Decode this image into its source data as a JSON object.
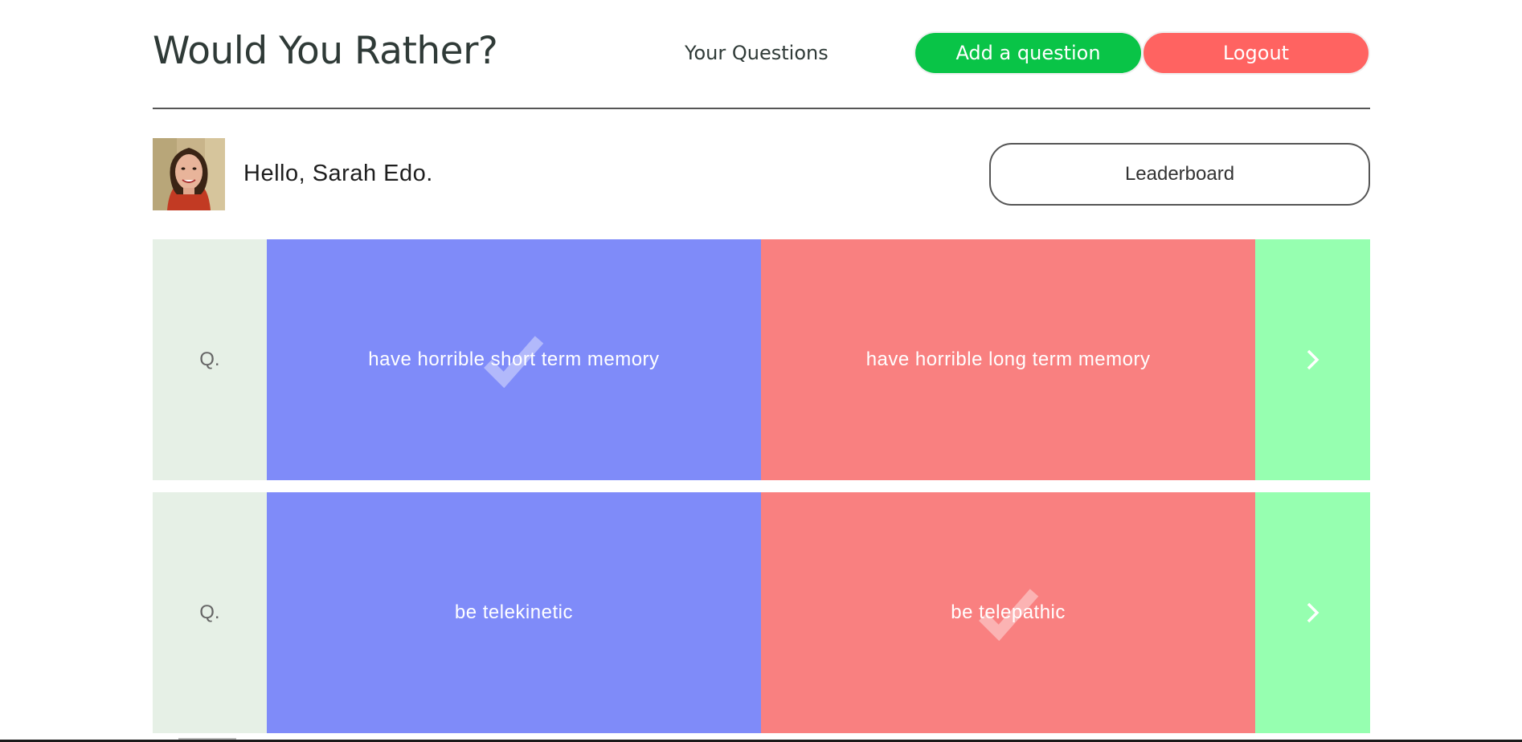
{
  "header": {
    "title": "Would You Rather?",
    "nav_your_questions": "Your Questions",
    "add_question_label": "Add a question",
    "logout_label": "Logout"
  },
  "user": {
    "greeting": "Hello, Sarah Edo.",
    "leaderboard_label": "Leaderboard"
  },
  "questions": [
    {
      "prefix": "Q.",
      "option_a": "have horrible short term memory",
      "option_b": "have horrible long term memory",
      "selected": "option_a"
    },
    {
      "prefix": "Q.",
      "option_a": "be telekinetic",
      "option_b": "be telepathic",
      "selected": "option_b"
    }
  ],
  "colors": {
    "add_button": "#09c447",
    "logout_button": "#ff6361",
    "option_a": "#7f8bf9",
    "option_b": "#f98080",
    "q_label_bg": "#e6f0e6",
    "next_bg": "#96ffb0"
  },
  "icons": {
    "check": "check-icon",
    "next": "chevron-right-icon"
  }
}
